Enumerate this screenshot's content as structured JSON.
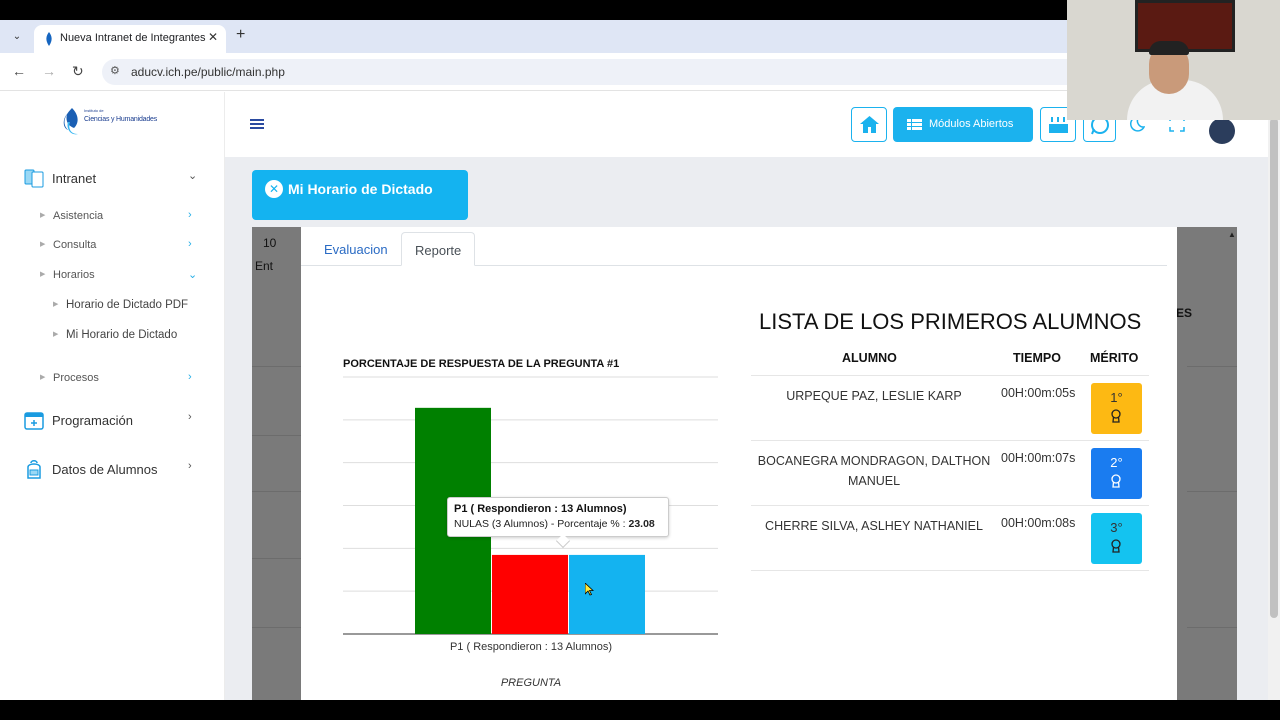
{
  "browser": {
    "tab_title": "Nueva Intranet de Integrantes",
    "url": "aducv.ich.pe/public/main.php"
  },
  "logo": {
    "text_small": "Instituto de",
    "text_main": "Ciencias y Humanidades"
  },
  "sidebar": {
    "items": [
      {
        "label": "Intranet",
        "icon": "tablet-icon"
      },
      {
        "label": "Programación",
        "icon": "calendar-icon"
      },
      {
        "label": "Datos de Alumnos",
        "icon": "backpack-icon"
      }
    ],
    "subitems": [
      {
        "label": "Asistencia"
      },
      {
        "label": "Consulta"
      },
      {
        "label": "Horarios"
      },
      {
        "label": "Procesos"
      }
    ],
    "horarios_items": [
      {
        "label": "Horario de Dictado PDF"
      },
      {
        "label": "Mi Horario de Dictado"
      }
    ]
  },
  "header": {
    "modulos_label": "Módulos Abiertos"
  },
  "page": {
    "title": "Mi Horario de Dictado",
    "background_fragments": {
      "num": "10",
      "ent": "Ent",
      "es": "ES"
    }
  },
  "modal": {
    "tabs": [
      {
        "label": "Evaluacion"
      },
      {
        "label": "Reporte"
      }
    ]
  },
  "chart_data": {
    "type": "bar",
    "title": "PORCENTAJE DE RESPUESTA DE LA PREGUNTA #1",
    "categories": [
      "P1 ( Respondieron : 13 Alumnos)"
    ],
    "xlabel": "PREGUNTA",
    "series": [
      {
        "values": [
          66
        ],
        "color": "#008000"
      },
      {
        "values": [
          23.08
        ],
        "color": "#ff0000"
      },
      {
        "values": [
          23.08
        ],
        "color": "#14b3f0"
      }
    ],
    "ylim": [
      0,
      75
    ],
    "grid": true,
    "tooltip": {
      "title": "P1 ( Respondieron : 13 Alumnos)",
      "line_prefix": "NULAS (3 Alumnos) - Porcentaje % :",
      "value": "23.08"
    }
  },
  "ranking": {
    "title": "LISTA DE LOS PRIMEROS ALUMNOS",
    "headers": {
      "alumno": "ALUMNO",
      "tiempo": "TIEMPO",
      "merito": "MÉRITO"
    },
    "rows": [
      {
        "name": "URPEQUE PAZ, LESLIE KARP",
        "time": "00H:00m:05s",
        "merit": "1°",
        "color": "#fdb913",
        "text_color": "#333333"
      },
      {
        "name": "BOCANEGRA MONDRAGON, DALTHON MANUEL",
        "time": "00H:00m:07s",
        "merit": "2°",
        "color": "#1a7cf0",
        "text_color": "#ffffff"
      },
      {
        "name": "CHERRE SILVA, ASLHEY NATHANIEL",
        "time": "00H:00m:08s",
        "merit": "3°",
        "color": "#14c3f0",
        "text_color": "#333333"
      }
    ]
  }
}
